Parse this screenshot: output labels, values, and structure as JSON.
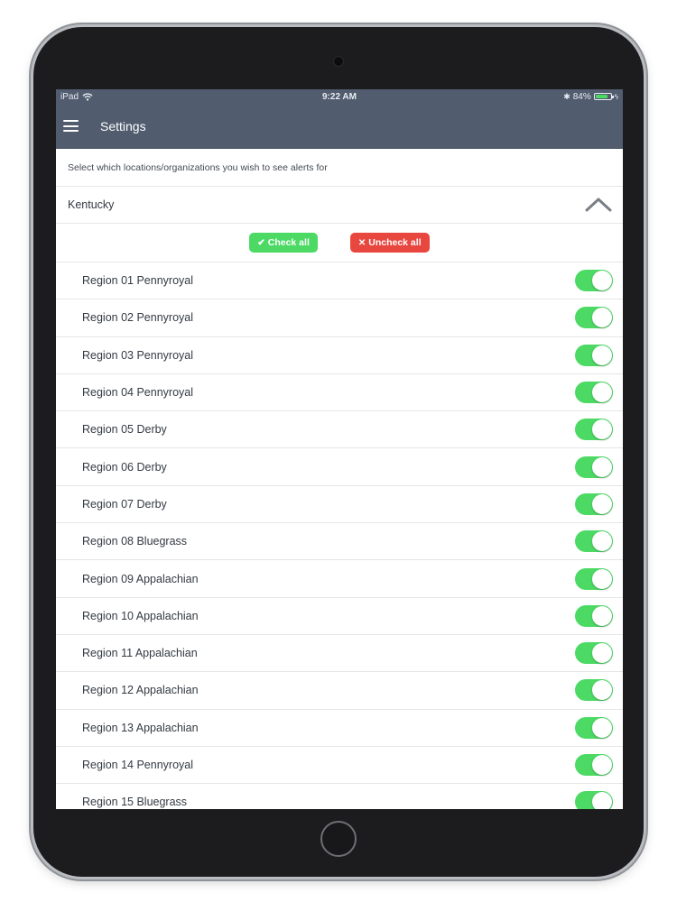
{
  "status_bar": {
    "device": "iPad",
    "time": "9:22 AM",
    "battery": "84%",
    "battery_level": 0.84,
    "icons": [
      "wifi-icon",
      "bluetooth-icon",
      "battery-icon",
      "charging-icon"
    ]
  },
  "header": {
    "menu_icon": "hamburger-icon",
    "title": "Settings"
  },
  "instruction": "Select which locations/organizations you wish to see alerts for",
  "section": {
    "title": "Kentucky",
    "expanded": true,
    "chevron_icon": "chevron-up-icon"
  },
  "actions": {
    "check_all": "Check all",
    "uncheck_all": "Uncheck all",
    "check_color": "#4cd964",
    "uncheck_color": "#e8473f"
  },
  "regions": [
    {
      "label": "Region 01 Pennyroyal",
      "enabled": true
    },
    {
      "label": "Region 02 Pennyroyal",
      "enabled": true
    },
    {
      "label": "Region 03 Pennyroyal",
      "enabled": true
    },
    {
      "label": "Region 04 Pennyroyal",
      "enabled": true
    },
    {
      "label": "Region 05 Derby",
      "enabled": true
    },
    {
      "label": "Region 06 Derby",
      "enabled": true
    },
    {
      "label": "Region 07 Derby",
      "enabled": true
    },
    {
      "label": "Region 08 Bluegrass",
      "enabled": true
    },
    {
      "label": "Region 09 Appalachian",
      "enabled": true
    },
    {
      "label": "Region 10 Appalachian",
      "enabled": true
    },
    {
      "label": "Region 11 Appalachian",
      "enabled": true
    },
    {
      "label": "Region 12 Appalachian",
      "enabled": true
    },
    {
      "label": "Region 13 Appalachian",
      "enabled": true
    },
    {
      "label": "Region 14 Pennyroyal",
      "enabled": true
    },
    {
      "label": "Region 15 Bluegrass",
      "enabled": true
    }
  ],
  "colors": {
    "nav_bar": "#515c6f",
    "toggle_on": "#4cd964"
  }
}
